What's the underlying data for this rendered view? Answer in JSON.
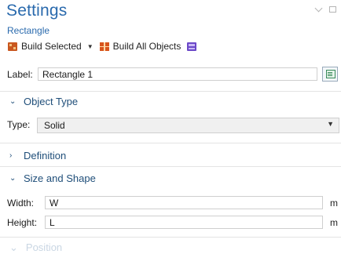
{
  "panel": {
    "title": "Settings",
    "subtitle": "Rectangle",
    "collapse_icon": "chevron-down-icon",
    "restore_icon": "restore-window-icon"
  },
  "toolbar": {
    "build_selected": "Build Selected",
    "build_all": "Build All Objects",
    "icons": [
      "build-selected-icon",
      "build-all-objects-icon",
      "geometry-icon"
    ]
  },
  "label_field": {
    "label": "Label:",
    "value": "Rectangle 1"
  },
  "sections": {
    "object_type": "Object Type",
    "definition": "Definition",
    "size_and_shape": "Size and Shape",
    "position": "Position"
  },
  "object_type": {
    "label": "Type:",
    "selected": "Solid"
  },
  "size_shape": {
    "width_label": "Width:",
    "width_value": "W",
    "width_unit": "m",
    "height_label": "Height:",
    "height_value": "L",
    "height_unit": "m"
  },
  "colors": {
    "title": "#2a6aad",
    "section": "#1f4e79"
  }
}
